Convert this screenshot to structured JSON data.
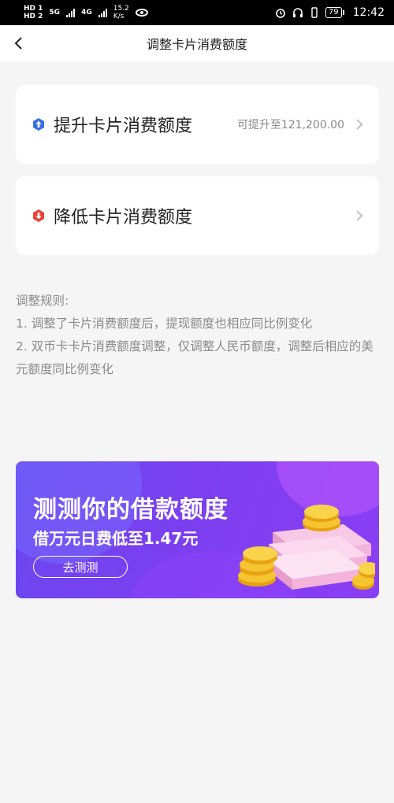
{
  "status_bar": {
    "net1": "HD 1",
    "net2": "HD 2",
    "gen": "5G",
    "gen2": "4G",
    "speed": "15.2",
    "speed_unit": "K/s",
    "battery": "79",
    "time": "12:42"
  },
  "nav": {
    "title": "调整卡片消费额度"
  },
  "options": [
    {
      "label": "提升卡片消费额度",
      "hint": "可提升至121,200.00",
      "icon": "arrow-up-icon",
      "icon_color": "#3a6fe0"
    },
    {
      "label": "降低卡片消费额度",
      "hint": "",
      "icon": "arrow-down-icon",
      "icon_color": "#e8443a"
    }
  ],
  "rules": {
    "heading": "调整规则:",
    "items": [
      "1. 调整了卡片消费额度后，提现额度也相应同比例变化",
      "2. 双币卡卡片消费额度调整，仅调整人民币额度，调整后相应的美元额度同比例变化"
    ]
  },
  "banner": {
    "title": "测测你的借款额度",
    "subtitle": "借万元日费低至1.47元",
    "button": "去测测"
  },
  "colors": {
    "background": "#f5f5f5",
    "banner_start": "#6a48f0",
    "banner_end": "#8b3ef2"
  }
}
